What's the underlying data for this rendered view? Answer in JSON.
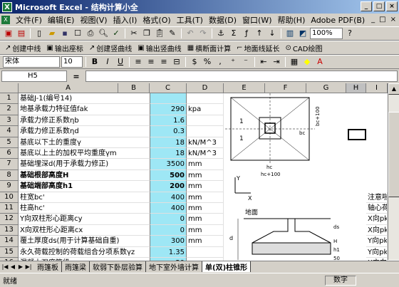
{
  "window": {
    "title": "Microsoft Excel - 结构计算小全",
    "app_icon": "X"
  },
  "menu": {
    "items": [
      "文件(F)",
      "编辑(E)",
      "视图(V)",
      "插入(I)",
      "格式(O)",
      "工具(T)",
      "数据(D)",
      "窗口(W)",
      "帮助(H)",
      "Adobe PDF(B)"
    ],
    "right": [
      "_",
      "□",
      "×"
    ]
  },
  "toolbar1": {
    "zoom": "100%"
  },
  "toolbar2": {
    "buttons": [
      "创建中线",
      "输出座标",
      "创建竖曲线",
      "输出竖曲线",
      "横断面计算",
      "地面线延长",
      "CAD绘图"
    ]
  },
  "format_bar": {
    "font": "宋体",
    "size": "10",
    "bold": "B",
    "italic": "I",
    "underline": "U"
  },
  "formula": {
    "name_box": "H5",
    "equals": "=",
    "content": ""
  },
  "columns": [
    "A",
    "B",
    "C",
    "D",
    "E",
    "F",
    "G",
    "H",
    "I"
  ],
  "rows": [
    {
      "n": "1",
      "a": "基础J-1(编号14)",
      "c": "",
      "d": "",
      "bold": false
    },
    {
      "n": "2",
      "a": "地基承载力特征值fak",
      "c": "290",
      "d": "kpa",
      "bold": false
    },
    {
      "n": "3",
      "a": "承载力修正系数ηb",
      "c": "1.6",
      "d": "",
      "bold": false
    },
    {
      "n": "4",
      "a": "承载力修正系数ηd",
      "c": "0.3",
      "d": "",
      "bold": false
    },
    {
      "n": "5",
      "a": "基底以下土的重度γ",
      "c": "18",
      "d": "kN/M^3",
      "bold": false
    },
    {
      "n": "6",
      "a": "基底以上土的加权平均重度γm",
      "c": "18",
      "d": "kN/M^3",
      "bold": false
    },
    {
      "n": "7",
      "a": "基础埋深d(用于承载力修正)",
      "c": "3500",
      "d": "mm",
      "bold": false
    },
    {
      "n": "8",
      "a": "基础根部高度H",
      "c": "500",
      "d": "mm",
      "bold": true
    },
    {
      "n": "9",
      "a": "基础端部高度h1",
      "c": "200",
      "d": "mm",
      "bold": true
    },
    {
      "n": "10",
      "a": "柱宽bc'",
      "c": "400",
      "d": "mm",
      "bold": false
    },
    {
      "n": "11",
      "a": "柱高hc'",
      "c": "400",
      "d": "mm",
      "bold": false
    },
    {
      "n": "12",
      "a": "Y向双柱形心距离cy",
      "c": "0",
      "d": "mm",
      "bold": false
    },
    {
      "n": "13",
      "a": "X向双柱形心距离cx",
      "c": "0",
      "d": "mm",
      "bold": false
    },
    {
      "n": "14",
      "a": "覆土厚度ds(用于计算基础自重)",
      "c": "300",
      "d": "mm",
      "bold": false
    },
    {
      "n": "15",
      "a": "永久荷载控制的荷载组合分项系数γz",
      "c": "1.35",
      "d": "",
      "bold": false
    },
    {
      "n": "16",
      "a": "混凝土强度等级",
      "c": "30",
      "d": "",
      "bold": false
    },
    {
      "n": "17",
      "a": "钢筋强度fy",
      "c": "300",
      "d": "N/mm^2",
      "bold": false
    }
  ],
  "col_i_notes": [
    {
      "row": "10",
      "text": "注意啦"
    },
    {
      "row": "11",
      "text": "轴心荷"
    },
    {
      "row": "12",
      "text": "X向pkm"
    },
    {
      "row": "13",
      "text": "X向pkm"
    },
    {
      "row": "14",
      "text": "Y向pkm"
    },
    {
      "row": "15",
      "text": "Y向pkm"
    },
    {
      "row": "16",
      "text": "X方向("
    },
    {
      "row": "17",
      "text": "X方向("
    }
  ],
  "drawing": {
    "label_1": "1",
    "label_1b": "1",
    "label_hc": "hc",
    "label_hc100": "hc+100",
    "label_bc": "bc",
    "label_y": "Y",
    "label_x": "X",
    "label_ground": "地面",
    "label_ds": "ds",
    "label_d": "d",
    "label_H": "H",
    "label_h1": "h1",
    "label_50": "50",
    "label_bc100": "bc+100"
  },
  "tabs": {
    "items": [
      "雨篷板",
      "雨篷梁",
      "软弱下卧层验算",
      "地下室外墙计算",
      "单(双)柱锥形"
    ],
    "active_index": 4
  },
  "status": {
    "left": "就绪",
    "num": "数字"
  }
}
